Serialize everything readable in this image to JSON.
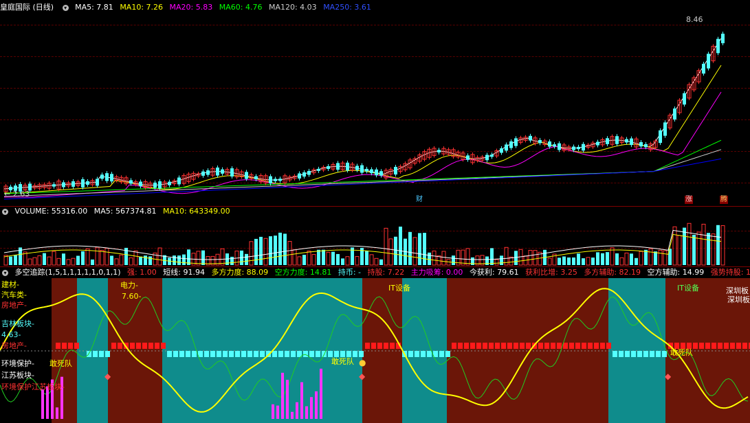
{
  "main_header": {
    "title": "皇庭国际 (日线)",
    "ma5": "MA5: 7.81",
    "ma10": "MA10: 7.26",
    "ma20": "MA20: 5.83",
    "ma60": "MA60: 4.76",
    "ma120": "MA120: 4.03",
    "ma250": "MA250: 3.61"
  },
  "main_chart": {
    "high_label": "8.46",
    "low_label": "← 2.63",
    "badge_cai": "财",
    "badge_zhang": "涨",
    "badge_teng": "腾"
  },
  "volume_header": {
    "volume": "VOLUME: 55316.00",
    "ma5": "MA5: 567374.81",
    "ma10": "MA10: 643349.00"
  },
  "indicator_header": {
    "name": "多空追踪(1,5,1,1,1,1,1,0,1,1)",
    "qiang": "强: 1.00",
    "duanxian": "短线: 91.94",
    "duofang": "多方力度: 88.09",
    "kongfang": "空方力度: 14.81",
    "chibi": "持币: -",
    "chigu": "持股: 7.22",
    "zhuli": "主力吸筹: 0.00",
    "jinhuoli": "今获利: 79.61",
    "huolibi": "获利比增: 3.25",
    "duofangfuzhu": "多方辅助: 82.19",
    "kongfangfuzhu": "空方辅助: 14.99",
    "qiangshi": "强势持股: 1"
  },
  "indicator_labels": {
    "jiancai": "建材-",
    "qiche": "汽车类-",
    "fangdichan": "房地产-",
    "jilin": "吉林板块-",
    "jilin_val": "4.63-",
    "fangchan2": "房地产-",
    "huanjing": "环境保护-",
    "jiangsu": "江苏板块-",
    "huanbao_jiangsu": "环境保护江苏板块-",
    "dianli": "电力-",
    "dianli_val": "7.60-",
    "gansidui1": "敢死队",
    "gansidui2": "敢死队",
    "gansidui3": "敢死队",
    "gansidui4": "敢死队",
    "it1": "IT设备",
    "it2": "IT设备",
    "shenzhen": "深圳板",
    "shenzhen2": "深圳板"
  },
  "colors": {
    "up": "#ff3232",
    "down": "#54ffff",
    "ma5": "#ffffff",
    "ma10": "#ffff00",
    "ma20": "#ff00ff",
    "ma60": "#00ff00",
    "ma120": "#cccccc",
    "ma250": "#0000ff",
    "panel_dark": "#6b1608",
    "panel_teal": "#0f8c8c"
  },
  "icons": [
    "circle-toggle-icon",
    "diamond-icon",
    "money-bag-icon"
  ]
}
